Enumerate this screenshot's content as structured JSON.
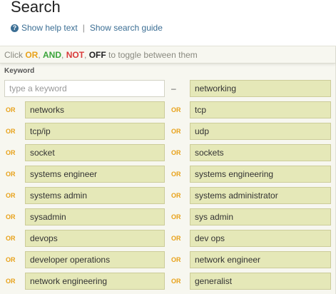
{
  "header": {
    "title": "Search",
    "help_link": "Show help text",
    "separator": "|",
    "guide_link": "Show search guide"
  },
  "toggle": {
    "prefix": "Click ",
    "or": "OR",
    "sep1": ", ",
    "and": "AND",
    "sep2": ", ",
    "not": "NOT",
    "sep3": ", ",
    "off": "OFF",
    "suffix": " to toggle between them"
  },
  "keyword": {
    "label": "Keyword",
    "placeholder": "type a keyword",
    "dash": "–",
    "first_right": "networking"
  },
  "rows": [
    {
      "op_left": "OR",
      "left": "networks",
      "op_right": "OR",
      "right": "tcp"
    },
    {
      "op_left": "OR",
      "left": "tcp/ip",
      "op_right": "OR",
      "right": "udp"
    },
    {
      "op_left": "OR",
      "left": "socket",
      "op_right": "OR",
      "right": "sockets"
    },
    {
      "op_left": "OR",
      "left": "systems engineer",
      "op_right": "OR",
      "right": "systems engineering"
    },
    {
      "op_left": "OR",
      "left": "systems admin",
      "op_right": "OR",
      "right": "systems administrator"
    },
    {
      "op_left": "OR",
      "left": "sysadmin",
      "op_right": "OR",
      "right": "sys admin"
    },
    {
      "op_left": "OR",
      "left": "devops",
      "op_right": "OR",
      "right": "dev ops"
    },
    {
      "op_left": "OR",
      "left": "developer operations",
      "op_right": "OR",
      "right": "network engineer"
    },
    {
      "op_left": "OR",
      "left": "network engineering",
      "op_right": "OR",
      "right": "generalist"
    }
  ],
  "colors": {
    "or": "#e8a21a",
    "and": "#3aa43a",
    "not": "#d93b3b",
    "off": "#222222",
    "field_bg": "#e5e8b8",
    "link": "#3b6e94"
  },
  "icons": {
    "help": "question-circle-icon"
  }
}
